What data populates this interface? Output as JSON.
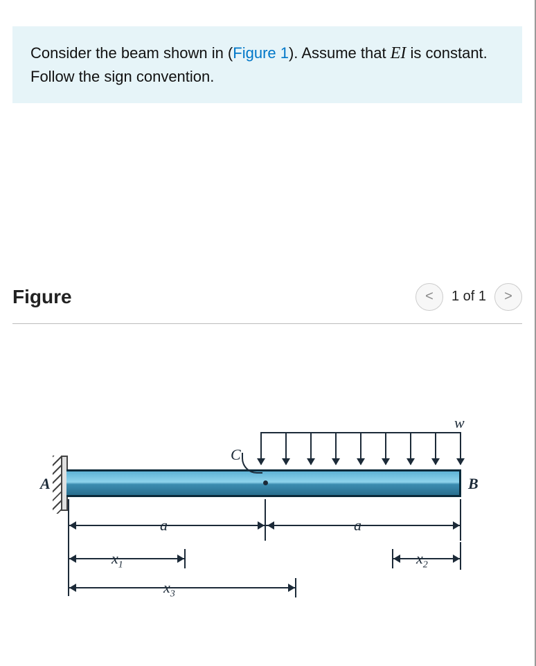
{
  "problem": {
    "text_before": "Consider the beam shown in (",
    "figure_link": "Figure 1",
    "text_after": "). Assume that ",
    "variable": "EI",
    "text_end": " is constant. Follow the sign convention."
  },
  "figure_header": {
    "title": "Figure",
    "pager": "1 of 1",
    "prev": "<",
    "next": ">"
  },
  "labels": {
    "A": "A",
    "B": "B",
    "C": "C",
    "w": "w",
    "a": "a",
    "x1": "x",
    "x1_sub": "1",
    "x2": "x",
    "x2_sub": "2",
    "x3": "x",
    "x3_sub": "3"
  },
  "diagram": {
    "type": "cantilever-beam",
    "support": "fixed-left",
    "load": "uniform-distributed-right-half",
    "point": "C-at-midspan",
    "spans": [
      "a",
      "a"
    ],
    "coords_from_A": [
      "x1",
      "x3"
    ],
    "coord_from_B": "x2"
  }
}
